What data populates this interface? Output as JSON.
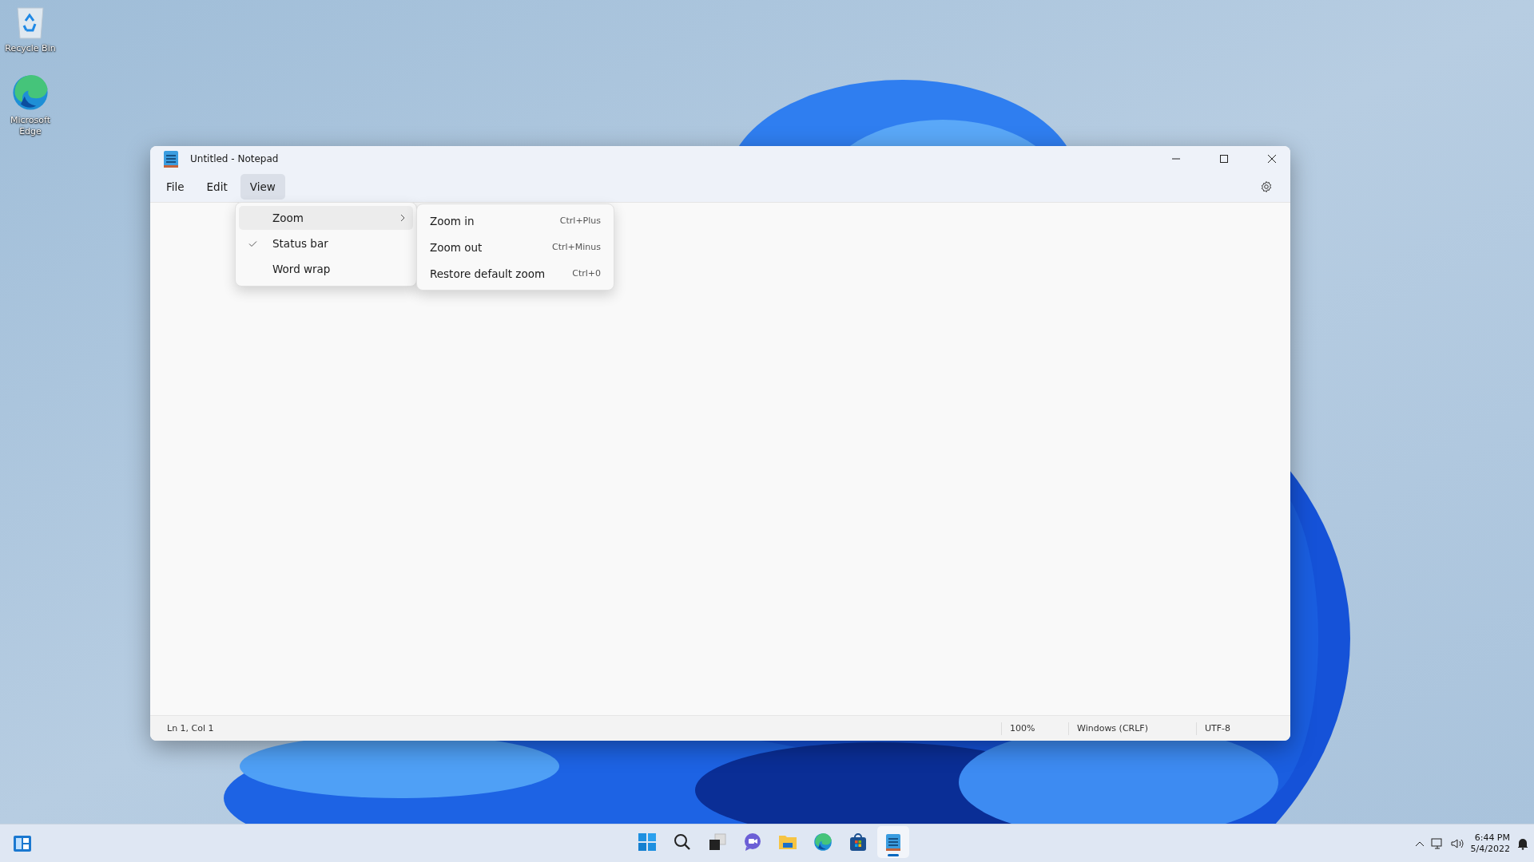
{
  "desktop_icons": [
    {
      "kind": "recycle",
      "label": "Recycle Bin"
    },
    {
      "kind": "edge",
      "label": "Microsoft Edge"
    }
  ],
  "window": {
    "title": "Untitled - Notepad",
    "menu": [
      {
        "label": "File",
        "selected": false
      },
      {
        "label": "Edit",
        "selected": false
      },
      {
        "label": "View",
        "selected": true
      }
    ],
    "view_menu": [
      {
        "label": "Zoom",
        "checked": false,
        "selected": true,
        "has_submenu": true
      },
      {
        "label": "Status bar",
        "checked": true,
        "selected": false,
        "has_submenu": false
      },
      {
        "label": "Word wrap",
        "checked": false,
        "selected": false,
        "has_submenu": false
      }
    ],
    "zoom_submenu": [
      {
        "label": "Zoom in",
        "shortcut": "Ctrl+Plus"
      },
      {
        "label": "Zoom out",
        "shortcut": "Ctrl+Minus"
      },
      {
        "label": "Restore default zoom",
        "shortcut": "Ctrl+0"
      }
    ],
    "status_bar": {
      "position": "Ln 1, Col 1",
      "zoom": "100%",
      "line_ending": "Windows (CRLF)",
      "encoding": "UTF-8"
    }
  },
  "taskbar": {
    "apps": [
      {
        "kind": "start",
        "selected": false
      },
      {
        "kind": "search",
        "selected": false
      },
      {
        "kind": "taskview",
        "selected": false
      },
      {
        "kind": "chat",
        "selected": false
      },
      {
        "kind": "files",
        "selected": false
      },
      {
        "kind": "edge",
        "selected": false
      },
      {
        "kind": "store",
        "selected": false
      },
      {
        "kind": "notepad",
        "selected": true
      }
    ],
    "clock": {
      "time": "6:44 PM",
      "date": "5/4/2022"
    }
  }
}
